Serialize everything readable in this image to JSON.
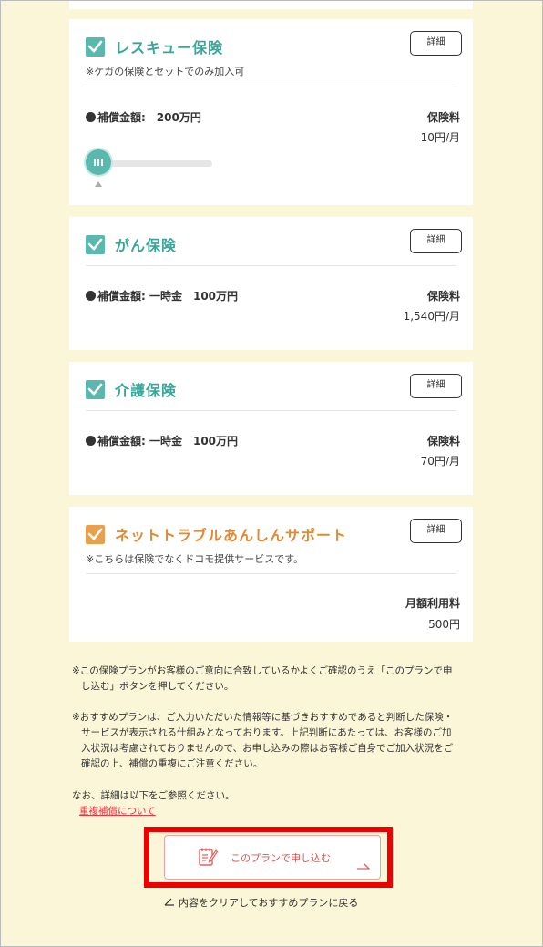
{
  "cards": [
    {
      "title": "レスキュー保険",
      "note": "※ケガの保険とセットでのみ加入可",
      "detail": "詳細",
      "coverage": "補償金額:　200万円",
      "price_label": "保険料",
      "price": "10円/月",
      "slider_level": 0
    },
    {
      "title": "がん保険",
      "detail": "詳細",
      "coverage": "補償金額: 一時金　100万円",
      "price_label": "保険料",
      "price": "1,540円/月"
    },
    {
      "title": "介護保険",
      "detail": "詳細",
      "coverage": "補償金額: 一時金　100万円",
      "price_label": "保険料",
      "price": "70円/月"
    },
    {
      "title": "ネットトラブルあんしんサポート",
      "note": "※こちらは保険でなくドコモ提供サービスです。",
      "detail": "詳細",
      "price_label": "月額利用料",
      "price": "500円"
    }
  ],
  "notes": {
    "p1_l1": "※この保険プランがお客様のご意向に合致しているかよくご確認のうえ「このプランで申",
    "p1_l2": "し込む」ボタンを押してください。",
    "p2_l1": "※おすすめプランは、ご入力いただいた情報等に基づきおすすめであると判断した保険・",
    "p2_l2": "サービスが表示される仕組みとなっております。上記判断にあたっては、お客様のご加",
    "p2_l3": "入状況は考慮されておりませんので、お申し込みの際はお客様ご自身でご加入状況をご",
    "p2_l4": "確認の上、補償の重複にご注意ください。",
    "p3": "なお、詳細は以下をご参照ください。",
    "link": "重複補償について"
  },
  "buttons": {
    "apply": "このプランで申し込む",
    "reset": "内容をクリアしておすすめプランに戻る"
  },
  "colors": {
    "background": "#fcf6d8",
    "teal": "#5bb8ae",
    "orange": "#e8a04e",
    "highlight": "#ee0000",
    "link": "#ee3344"
  }
}
